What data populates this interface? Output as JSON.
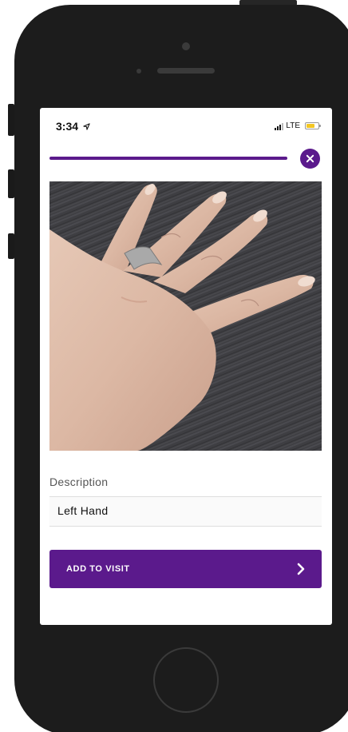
{
  "status_bar": {
    "time": "3:34",
    "network": "LTE",
    "battery_color": "#f3c623",
    "battery_level": 0.7,
    "location_icon": "location-arrow-icon"
  },
  "header": {
    "progress_color": "#5b1a8c",
    "close_icon": "close-icon"
  },
  "photo": {
    "subject": "hand-photo"
  },
  "description": {
    "label": "Description",
    "value": "Left Hand"
  },
  "actions": {
    "add_to_visit_label": "ADD TO VISIT",
    "add_to_visit_icon": "chevron-right-icon",
    "accent_color": "#5b1a8c"
  }
}
